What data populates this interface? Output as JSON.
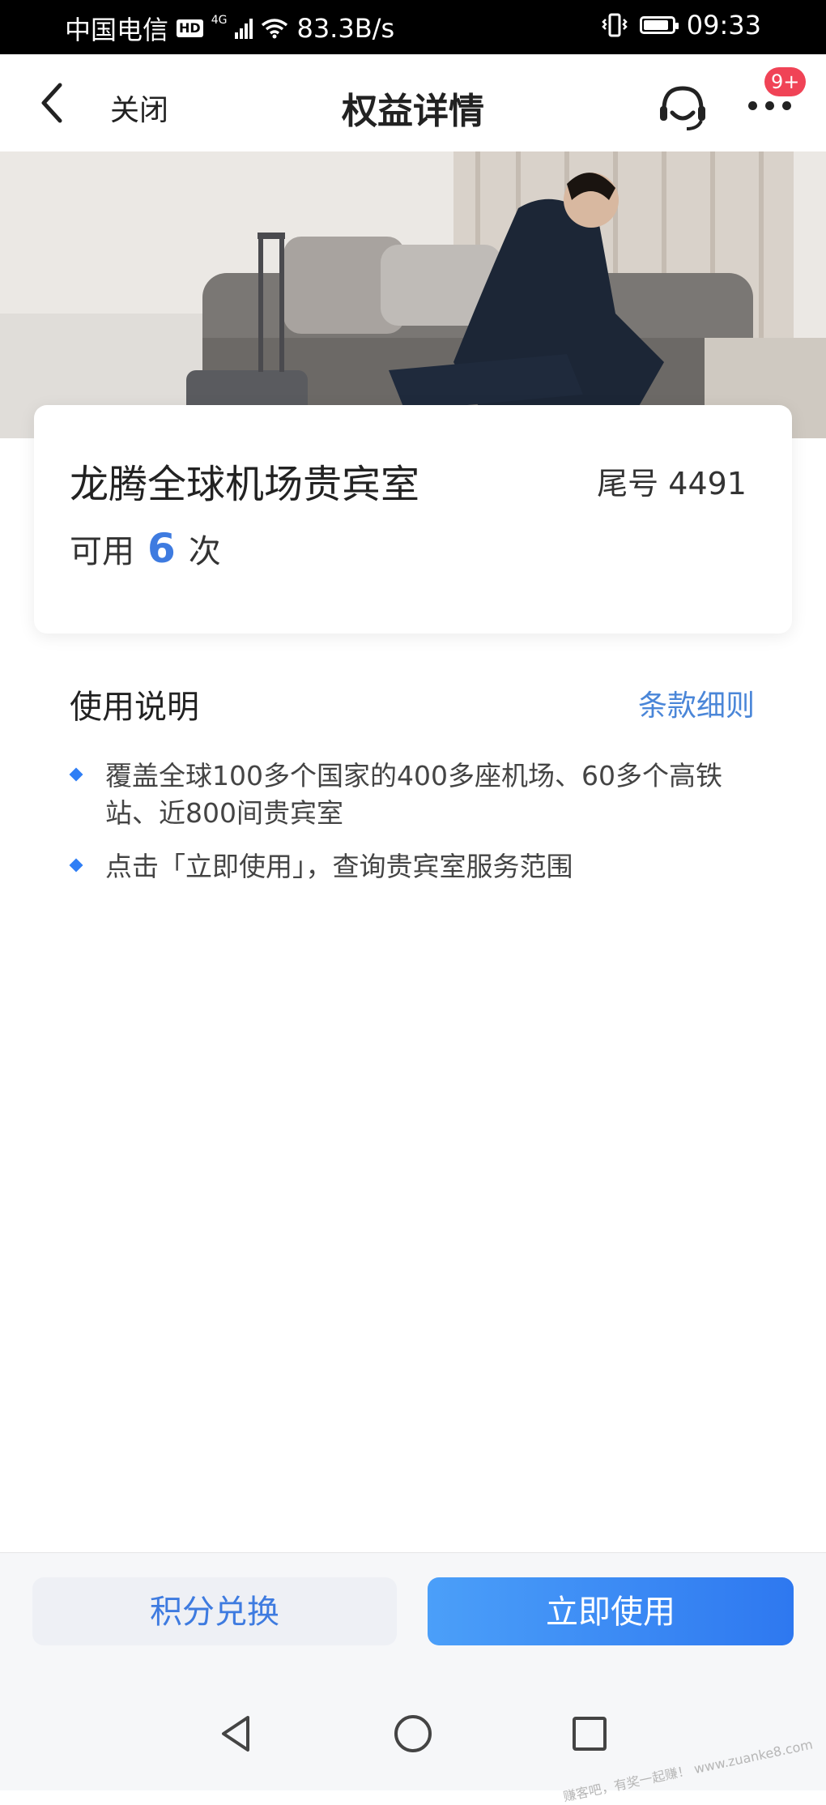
{
  "status_bar": {
    "carrier": "中国电信",
    "hd": "HD",
    "network": "4G",
    "speed": "83.3B/s",
    "time": "09:33",
    "icons": [
      "hd-icon",
      "signal-icon",
      "wifi-icon",
      "vibrate-icon",
      "battery-icon"
    ],
    "battery_level": 0.9
  },
  "nav": {
    "close_label": "关闭",
    "title": "权益详情",
    "badge": "9+",
    "icons": [
      "back-arrow-icon",
      "customer-service-icon",
      "more-icon"
    ]
  },
  "card": {
    "title": "龙腾全球机场贵宾室",
    "tail_label": "尾号",
    "tail_number": "4491",
    "available_prefix": "可用",
    "available_count": "6",
    "available_suffix": "次"
  },
  "instructions": {
    "title": "使用说明",
    "terms_link": "条款细则",
    "items": [
      "覆盖全球100多个国家的400多座机场、60多个高铁站、近800间贵宾室",
      "点击「立即使用」，查询贵宾室服务范围"
    ]
  },
  "actions": {
    "exchange_label": "积分兑换",
    "use_label": "立即使用"
  },
  "system_nav": {
    "icons": [
      "back-triangle-icon",
      "home-circle-icon",
      "recents-square-icon"
    ]
  },
  "watermark": "赚客吧，有奖一起赚！ www.zuanke8.com",
  "colors": {
    "accent_blue": "#3e7be0",
    "button_gradient_start": "#4b9ff9",
    "button_gradient_end": "#2e78f0",
    "badge_red": "#f04356",
    "bullet_blue": "#2f7ef5"
  }
}
